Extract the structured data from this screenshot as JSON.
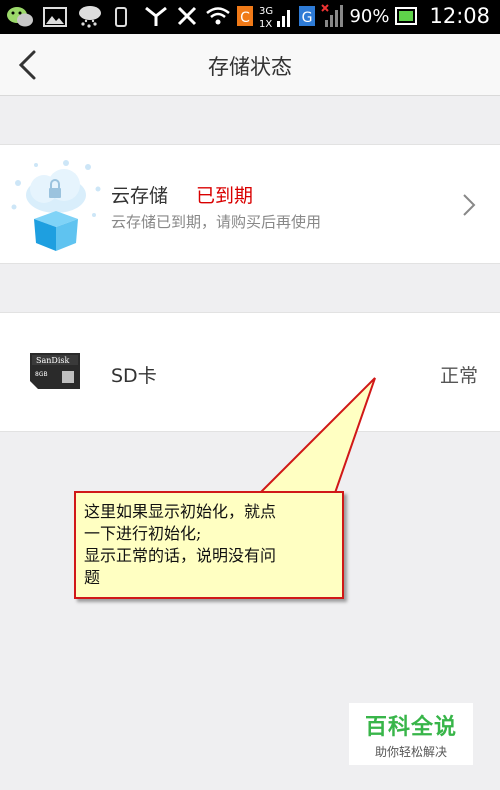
{
  "status_bar": {
    "battery": "90%",
    "time": "12:08",
    "net_3g": "3G",
    "net_1x": "1X",
    "carrier_c": "C",
    "carrier_g": "G"
  },
  "nav": {
    "title": "存储状态"
  },
  "cloud": {
    "title": "云存储",
    "status": "已到期",
    "subtitle": "云存储已到期，请购买后再使用"
  },
  "sd": {
    "label": "SD卡",
    "status": "正常",
    "card_brand": "SanDisk",
    "card_size": "8GB"
  },
  "annotation": {
    "line1": "这里如果显示初始化，就点",
    "line2": "一下进行初始化;",
    "line3": "显示正常的话，说明没有问",
    "line4": "题"
  },
  "watermark": {
    "main": "百科全说",
    "sub": "助你轻松解决"
  },
  "colors": {
    "expired": "#d90000",
    "accent_green": "#38b549",
    "callout_bg": "#ffffc2",
    "callout_border": "#d01818"
  }
}
